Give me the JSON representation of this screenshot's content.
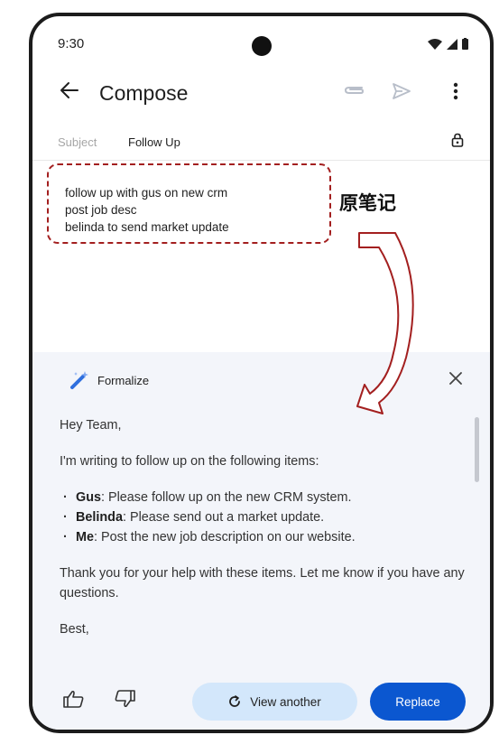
{
  "status_bar": {
    "time": "9:30"
  },
  "app_bar": {
    "title": "Compose"
  },
  "subject": {
    "label": "Subject",
    "value": "Follow Up"
  },
  "notes": {
    "lines": [
      "follow up with gus on new crm",
      "post job desc",
      "belinda to send market update"
    ]
  },
  "annotation": {
    "label": "原笔记",
    "color": "#a31f1f"
  },
  "ai_panel": {
    "label": "Formalize",
    "greeting": "Hey Team,",
    "intro": "I'm writing to follow up on the following items:",
    "items": [
      {
        "name": "Gus",
        "text": ": Please follow up on the new CRM system."
      },
      {
        "name": "Belinda",
        "text": ": Please send out a market update."
      },
      {
        "name": "Me",
        "text": ": Post the new job description on our website."
      }
    ],
    "thanks": "Thank you for your help with these items. Let me know if you have any questions.",
    "signoff": "Best,",
    "view_another_label": "View another",
    "replace_label": "Replace"
  },
  "colors": {
    "accent": "#0b57d0",
    "tonal_button": "#d3e7fb",
    "panel_bg": "#f3f5fa",
    "sparkle": "#2f6fde"
  },
  "icons": {
    "back": "arrow-back-icon",
    "attach": "attach-icon",
    "send": "send-icon",
    "more": "more-vert-icon",
    "lock": "lock-icon",
    "sparkle": "sparkle-pen-icon",
    "close": "close-icon",
    "thumb_up": "thumb-up-icon",
    "thumb_down": "thumb-down-icon",
    "refresh": "refresh-icon"
  }
}
